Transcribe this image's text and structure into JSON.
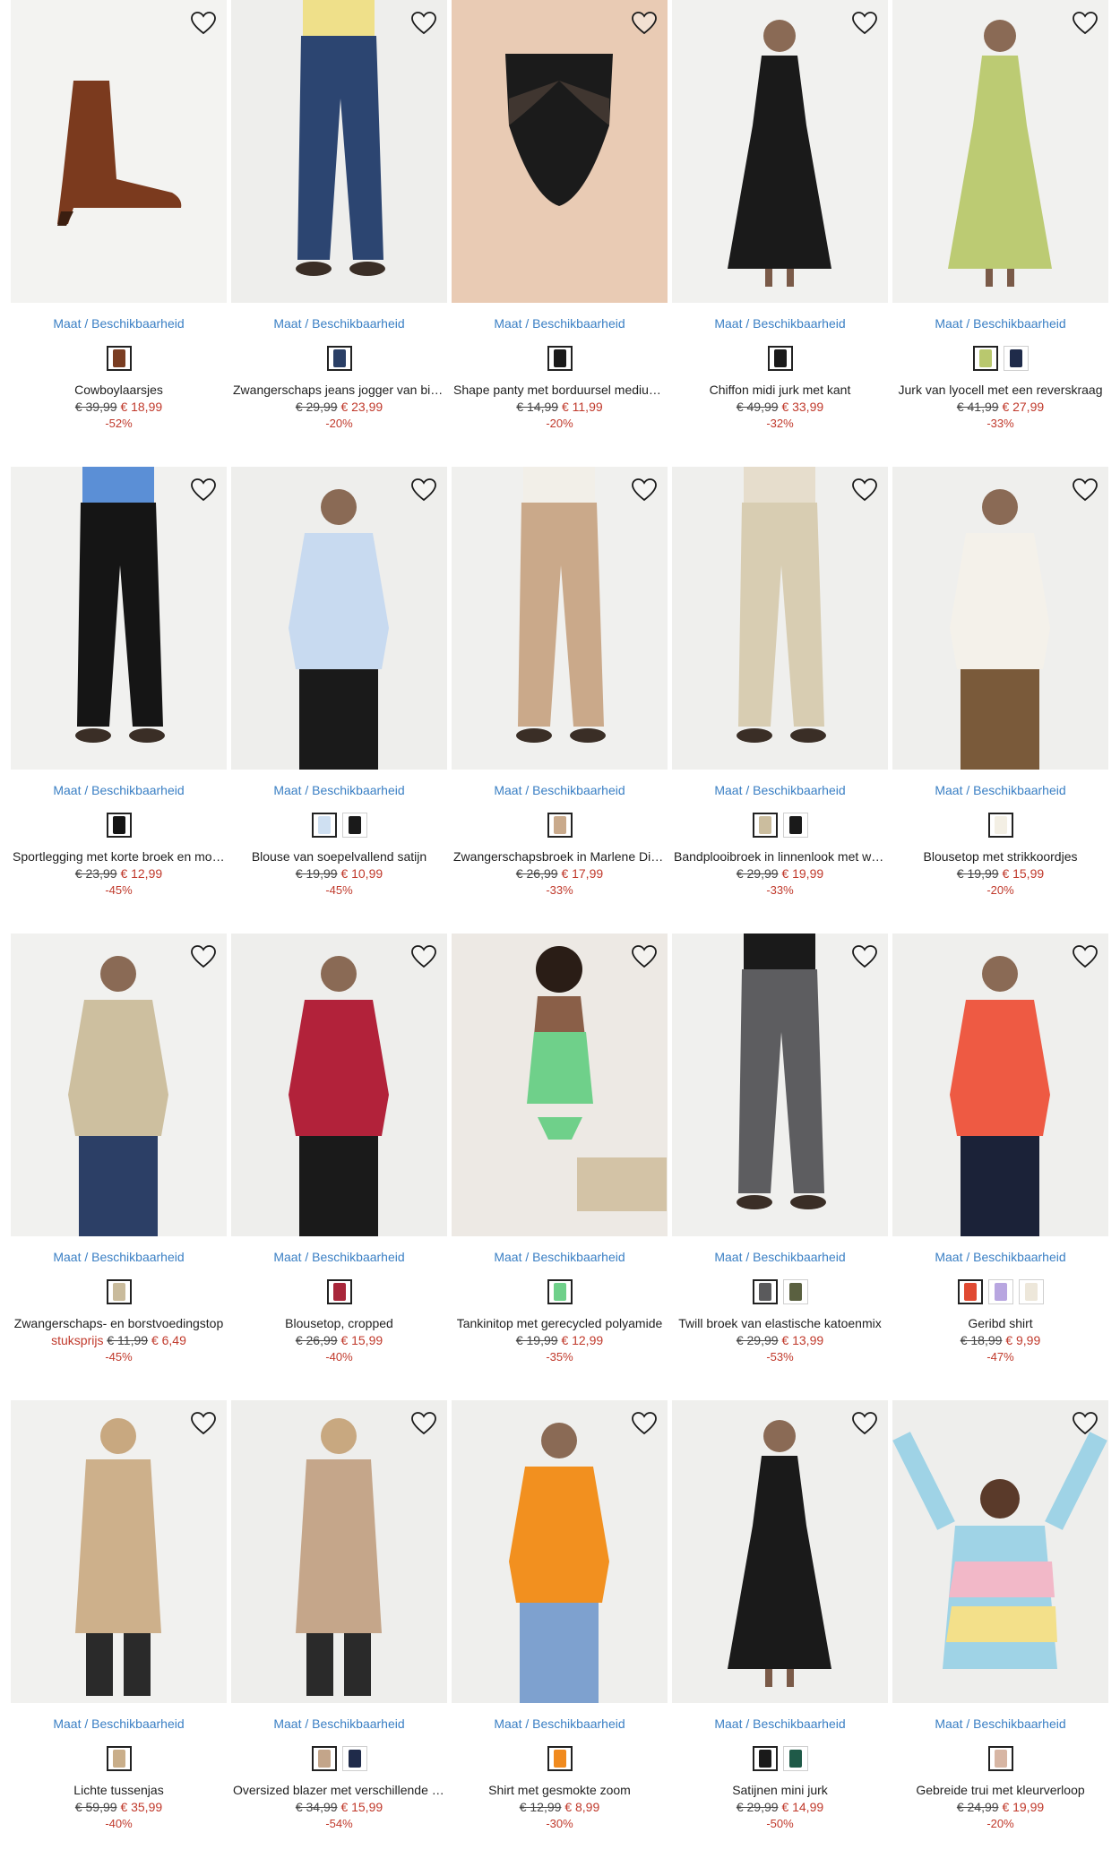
{
  "size_link_label": "Maat / Beschikbaarheid",
  "products": [
    {
      "title": "Cowboylaarsjes",
      "old_price": "€ 39,99",
      "new_price": "€ 18,99",
      "discount": "-52%",
      "unit_label": "",
      "bg": "#f3f3f1",
      "swatches": [
        "#7a3d22"
      ],
      "fig": {
        "type": "boot",
        "color": "#7b3a1e"
      }
    },
    {
      "title": "Zwangerschaps jeans jogger van biologisch katoen",
      "old_price": "€ 29,99",
      "new_price": "€ 23,99",
      "discount": "-20%",
      "unit_label": "",
      "bg": "#eeeeec",
      "swatches": [
        "#2a3f66"
      ],
      "fig": {
        "type": "pants",
        "color": "#2c4571",
        "top": "#efe08a"
      }
    },
    {
      "title": "Shape panty met borduursel medium shaping",
      "old_price": "€ 14,99",
      "new_price": "€ 11,99",
      "discount": "-20%",
      "unit_label": "",
      "bg": "#efe9e5",
      "swatches": [
        "#1b1b1b"
      ],
      "fig": {
        "type": "panty",
        "color": "#1b1b1b"
      }
    },
    {
      "title": "Chiffon midi jurk met kant",
      "old_price": "€ 49,99",
      "new_price": "€ 33,99",
      "discount": "-32%",
      "unit_label": "",
      "bg": "#f1f1ef",
      "swatches": [
        "#1a1a1a"
      ],
      "fig": {
        "type": "dress",
        "color": "#1a1a1a"
      }
    },
    {
      "title": "Jurk van lyocell met een reverskraag",
      "old_price": "€ 41,99",
      "new_price": "€ 27,99",
      "discount": "-33%",
      "unit_label": "",
      "bg": "#f1f1ef",
      "swatches": [
        "#b9c86e",
        "#1f2b4a"
      ],
      "fig": {
        "type": "dress",
        "color": "#bccb73"
      }
    },
    {
      "title": "Sportlegging met korte broek en mobielzak",
      "old_price": "€ 23,99",
      "new_price": "€ 12,99",
      "discount": "-45%",
      "unit_label": "",
      "bg": "#f1f1ef",
      "swatches": [
        "#141414"
      ],
      "fig": {
        "type": "pants",
        "color": "#151515",
        "top": "#5b8fd6"
      }
    },
    {
      "title": "Blouse van soepelvallend satijn",
      "old_price": "€ 19,99",
      "new_price": "€ 10,99",
      "discount": "-45%",
      "unit_label": "",
      "bg": "#eeeeec",
      "swatches": [
        "#cfe0f2",
        "#1a1a1a"
      ],
      "fig": {
        "type": "top",
        "color": "#c8daf0",
        "bottom": "#1a1a1a"
      }
    },
    {
      "title": "Zwangerschapsbroek in Marlene Dietrich stijl",
      "old_price": "€ 26,99",
      "new_price": "€ 17,99",
      "discount": "-33%",
      "unit_label": "",
      "bg": "#f0f0ee",
      "swatches": [
        "#c9aa8c"
      ],
      "fig": {
        "type": "pants",
        "color": "#caa98a",
        "top": "#f2efe8"
      }
    },
    {
      "title": "Bandplooibroek in linnenlook met wijde pijpen",
      "old_price": "€ 29,99",
      "new_price": "€ 19,99",
      "discount": "-33%",
      "unit_label": "",
      "bg": "#efefed",
      "swatches": [
        "#cbbd9e",
        "#1a1a1a"
      ],
      "fig": {
        "type": "pants",
        "color": "#d8cdb2",
        "top": "#e6ddcc"
      }
    },
    {
      "title": "Blousetop met strikkoordjes",
      "old_price": "€ 19,99",
      "new_price": "€ 15,99",
      "discount": "-20%",
      "unit_label": "",
      "bg": "#efefed",
      "swatches": [
        "#f3efe4"
      ],
      "fig": {
        "type": "top",
        "color": "#f4f1ea",
        "bottom": "#7a5a3a"
      }
    },
    {
      "title": "Zwangerschaps- en borstvoedingstop",
      "old_price": "€ 11,99",
      "new_price": "€ 6,49",
      "discount": "-45%",
      "unit_label": "stuksprijs",
      "bg": "#f1f1ef",
      "swatches": [
        "#c9bb9c"
      ],
      "fig": {
        "type": "top",
        "color": "#cdbf9f",
        "bottom": "#2c3f66"
      }
    },
    {
      "title": "Blousetop, cropped",
      "old_price": "€ 26,99",
      "new_price": "€ 15,99",
      "discount": "-40%",
      "unit_label": "",
      "bg": "#eeeeec",
      "swatches": [
        "#a8263a"
      ],
      "fig": {
        "type": "top",
        "color": "#b2223a",
        "bottom": "#1a1a1a"
      }
    },
    {
      "title": "Tankinitop met gerecycled polyamide",
      "old_price": "€ 19,99",
      "new_price": "€ 12,99",
      "discount": "-35%",
      "unit_label": "",
      "bg": "#ede9e4",
      "swatches": [
        "#6fd08a"
      ],
      "fig": {
        "type": "swim",
        "color": "#6fd08a"
      }
    },
    {
      "title": "Twill broek van elastische katoenmix",
      "old_price": "€ 29,99",
      "new_price": "€ 13,99",
      "discount": "-53%",
      "unit_label": "",
      "bg": "#f0f0ee",
      "swatches": [
        "#5a5a5c",
        "#5a6040"
      ],
      "fig": {
        "type": "pants",
        "color": "#5d5d60",
        "top": "#1a1a1a"
      }
    },
    {
      "title": "Geribd shirt",
      "old_price": "€ 18,99",
      "new_price": "€ 9,99",
      "discount": "-47%",
      "unit_label": "",
      "bg": "#efefed",
      "swatches": [
        "#e04a32",
        "#b8a6e0",
        "#ede7da"
      ],
      "fig": {
        "type": "top",
        "color": "#ee5a43",
        "bottom": "#1b2238"
      }
    },
    {
      "title": "Lichte tussenjas",
      "old_price": "€ 59,99",
      "new_price": "€ 35,99",
      "discount": "-40%",
      "unit_label": "",
      "bg": "#f1f1ef",
      "swatches": [
        "#c9ae8a"
      ],
      "fig": {
        "type": "coat",
        "color": "#cdb08b"
      }
    },
    {
      "title": "Oversized blazer met verschillende draagwijzen",
      "old_price": "€ 34,99",
      "new_price": "€ 15,99",
      "discount": "-54%",
      "unit_label": "",
      "bg": "#eeeeec",
      "swatches": [
        "#c3a58a",
        "#1f2b4a"
      ],
      "fig": {
        "type": "coat",
        "color": "#c5a68a"
      }
    },
    {
      "title": "Shirt met gesmokte zoom",
      "old_price": "€ 12,99",
      "new_price": "€ 8,99",
      "discount": "-30%",
      "unit_label": "",
      "bg": "#efefed",
      "swatches": [
        "#f08a1e"
      ],
      "fig": {
        "type": "top",
        "color": "#f2901f",
        "bottom": "#7ea1cf"
      }
    },
    {
      "title": "Satijnen mini jurk",
      "old_price": "€ 29,99",
      "new_price": "€ 14,99",
      "discount": "-50%",
      "unit_label": "",
      "bg": "#efefed",
      "swatches": [
        "#1a1a1a",
        "#1f5a48"
      ],
      "fig": {
        "type": "dress",
        "color": "#1a1a1a"
      }
    },
    {
      "title": "Gebreide trui met kleurverloop",
      "old_price": "€ 24,99",
      "new_price": "€ 19,99",
      "discount": "-20%",
      "unit_label": "",
      "bg": "#eeeeec",
      "swatches": [
        "#d7b6a4"
      ],
      "fig": {
        "type": "knit",
        "color": "#9fd3e6"
      }
    }
  ]
}
